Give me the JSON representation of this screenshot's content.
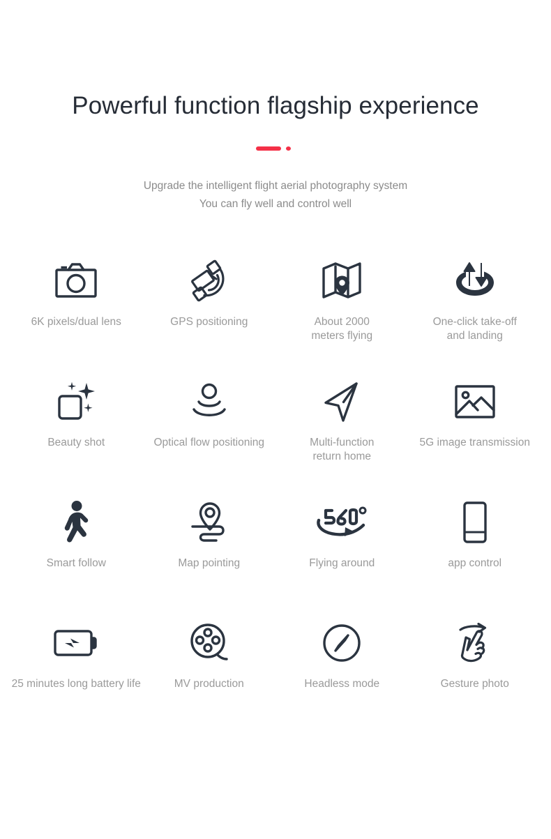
{
  "header": {
    "title": "Powerful function flagship experience",
    "divider": {
      "bar_color": "#f43047",
      "dot_color": "#f43047"
    },
    "subtitle_line1": "Upgrade the intelligent flight aerial photography system",
    "subtitle_line2": "You can fly well and control well"
  },
  "colors": {
    "title": "#262c36",
    "subtitle": "#8b8b8b",
    "label": "#9a9a9a",
    "icon": "#2b3440",
    "accent": "#f43047",
    "background": "#ffffff"
  },
  "features": [
    {
      "icon": "camera-icon",
      "label": "6K pixels/dual lens"
    },
    {
      "icon": "satellite-gps-icon",
      "label": "GPS positioning"
    },
    {
      "icon": "map-pin-icon",
      "label": "About 2000\nmeters flying"
    },
    {
      "icon": "takeoff-landing-icon",
      "label": "One-click take-off\nand landing"
    },
    {
      "icon": "sparkle-square-icon",
      "label": "Beauty shot"
    },
    {
      "icon": "optical-flow-icon",
      "label": "Optical flow positioning"
    },
    {
      "icon": "navigation-arrow-icon",
      "label": "Multi-function\nreturn home"
    },
    {
      "icon": "image-photo-icon",
      "label": "5G image transmission"
    },
    {
      "icon": "walking-person-icon",
      "label": "Smart follow"
    },
    {
      "icon": "map-route-pin-icon",
      "label": "Map pointing"
    },
    {
      "icon": "rotate-360-icon",
      "label": "Flying around"
    },
    {
      "icon": "smartphone-icon",
      "label": "app control"
    },
    {
      "icon": "battery-charge-icon",
      "label": "25 minutes long battery life"
    },
    {
      "icon": "film-reel-icon",
      "label": "MV production"
    },
    {
      "icon": "compass-icon",
      "label": "Headless mode"
    },
    {
      "icon": "hand-gesture-icon",
      "label": "Gesture photo"
    }
  ]
}
